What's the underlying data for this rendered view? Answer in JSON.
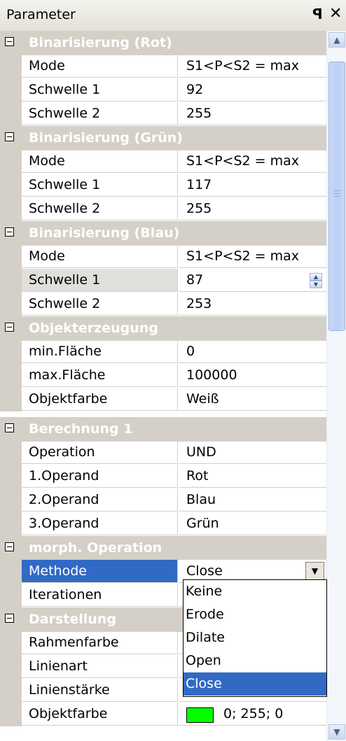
{
  "panel": {
    "title": "Parameter",
    "pin_icon": "ꟼ",
    "close_icon": "✕"
  },
  "categories": [
    {
      "label": "Binarisierung (Rot)"
    },
    {
      "label": "Binarisierung (Grün)"
    },
    {
      "label": "Binarisierung (Blau)"
    },
    {
      "label": "Objekterzeugung"
    },
    {
      "label": "Berechnung 1"
    },
    {
      "label": "morph. Operation"
    },
    {
      "label": "Darstellung"
    }
  ],
  "props": {
    "rot_mode": {
      "name": "Mode",
      "value": "S1<P<S2 = max"
    },
    "rot_s1": {
      "name": "Schwelle 1",
      "value": "92"
    },
    "rot_s2": {
      "name": "Schwelle 2",
      "value": "255"
    },
    "gruen_mode": {
      "name": "Mode",
      "value": "S1<P<S2 = max"
    },
    "gruen_s1": {
      "name": "Schwelle 1",
      "value": "117"
    },
    "gruen_s2": {
      "name": "Schwelle 2",
      "value": "255"
    },
    "blau_mode": {
      "name": "Mode",
      "value": "S1<P<S2 = max"
    },
    "blau_s1": {
      "name": "Schwelle 1",
      "value": "87"
    },
    "blau_s2": {
      "name": "Schwelle 2",
      "value": "253"
    },
    "min_flaeche": {
      "name": "min.Fläche",
      "value": "0"
    },
    "max_flaeche": {
      "name": "max.Fläche",
      "value": "100000"
    },
    "objektfarbe1": {
      "name": "Objektfarbe",
      "value": "Weiß"
    },
    "operation": {
      "name": "Operation",
      "value": "UND"
    },
    "op1": {
      "name": "1.Operand",
      "value": "Rot"
    },
    "op2": {
      "name": "2.Operand",
      "value": "Blau"
    },
    "op3": {
      "name": "3.Operand",
      "value": "Grün"
    },
    "methode": {
      "name": "Methode",
      "value": "Close"
    },
    "iterationen": {
      "name": "Iterationen",
      "value": ""
    },
    "rahmenfarbe": {
      "name": "Rahmenfarbe",
      "value": ""
    },
    "linienart": {
      "name": "Linienart",
      "value": ""
    },
    "linienstaerke": {
      "name": "Linienstärke",
      "value": ""
    },
    "objektfarbe2": {
      "name": "Objektfarbe",
      "value": "0; 255; 0",
      "swatch_color": "#00ff00"
    }
  },
  "dropdown": {
    "options": [
      "Keine",
      "Erode",
      "Dilate",
      "Open",
      "Close"
    ],
    "selected": "Close"
  },
  "colors": {
    "selection": "#316ac5",
    "category_bg": "#d4d0c8"
  }
}
